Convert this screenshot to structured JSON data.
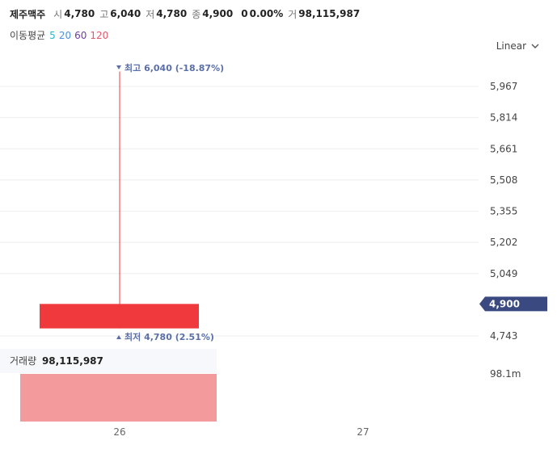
{
  "header": {
    "name": "제주맥주",
    "open_label": "시",
    "open_value": "4,780",
    "high_label": "고",
    "high_value": "6,040",
    "low_label": "저",
    "low_value": "4,780",
    "close_label": "종",
    "close_value": "4,900",
    "change_value": "0",
    "change_pct": "0.00%",
    "volume_label": "거",
    "volume_value": "98,115,987"
  },
  "moving_average": {
    "label": "이동평균",
    "periods": [
      {
        "label": "5",
        "color": "#26b5c6"
      },
      {
        "label": "20",
        "color": "#4a90d9"
      },
      {
        "label": "60",
        "color": "#6a3fa0"
      },
      {
        "label": "120",
        "color": "#e05a6a"
      }
    ]
  },
  "scale_selector": {
    "label": "Linear"
  },
  "volume_panel": {
    "label": "거래량",
    "value": "98,115,987",
    "axis_label": "98.1m"
  },
  "chart_data": {
    "type": "candlestick",
    "price_ticks": [
      "5,967",
      "5,814",
      "5,661",
      "5,508",
      "5,355",
      "5,202",
      "5,049",
      "4,743"
    ],
    "price_tick_values": [
      5967,
      5814,
      5661,
      5508,
      5355,
      5202,
      5049,
      4743
    ],
    "current_price_label": "4,900",
    "current_price": 4900,
    "x_ticks": [
      "26",
      "27"
    ],
    "candles": [
      {
        "x": "26",
        "open": 4780,
        "high": 6040,
        "low": 4780,
        "close": 4900,
        "volume": 98115987
      }
    ],
    "high_annotation": "최고 6,040 (-18.87%)",
    "low_annotation": "최저 4,780 (2.51%)",
    "colors": {
      "candle": "#f0393c",
      "volume_bar": "#f29a9c",
      "annotation": "#5b6fa8",
      "price_tag": "#3a4a80",
      "grid": "#eeeeee"
    }
  }
}
